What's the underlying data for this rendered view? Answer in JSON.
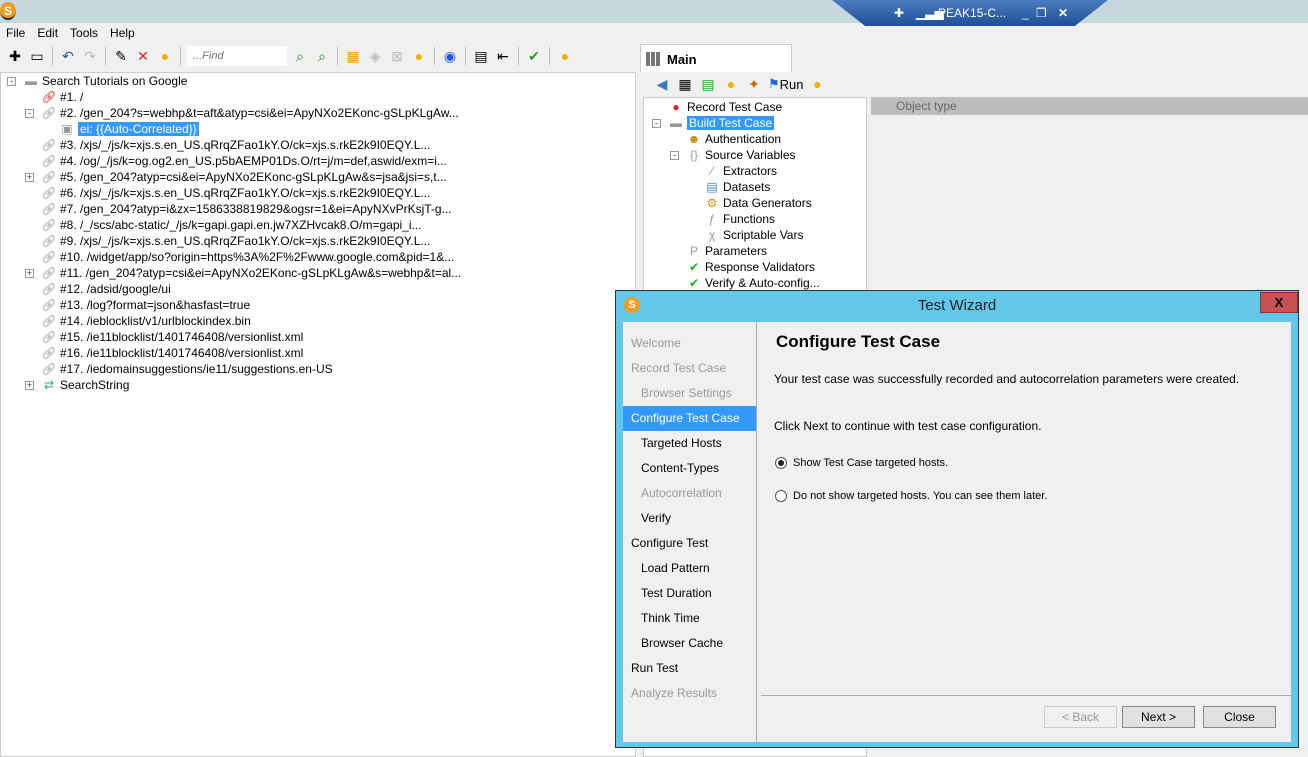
{
  "titlebar": {
    "remote_session": "PEAK15-C..."
  },
  "menu": [
    "File",
    "Edit",
    "Tools",
    "Help"
  ],
  "toolbar": {
    "find_placeholder": "...Find",
    "icons": [
      "add-icon",
      "remove-icon",
      "undo-icon",
      "redo-icon",
      "edit-icon",
      "delete-icon",
      "hint-icon",
      "find-prev-icon",
      "find-next-icon",
      "hosts-icon",
      "correlate-icon",
      "disabled-icon",
      "hint-icon",
      "view-icon",
      "details-icon",
      "collapse-icon",
      "verify-icon",
      "hint-icon"
    ]
  },
  "left_tree": {
    "root": "Search Tutorials on Google",
    "items": [
      {
        "label": "#1. /",
        "level": 1,
        "icon": "link-red-icon"
      },
      {
        "label": "#2. /gen_204?s=webhp&t=aft&atyp=csi&ei=ApyNXo2EKonc-gSLpKLgAw...",
        "level": 1,
        "icon": "link-icon",
        "expander": "-"
      },
      {
        "label": "ei: {{Auto-Correlated}}",
        "level": 2,
        "icon": "parameter-icon",
        "selected": true
      },
      {
        "label": "#3. /xjs/_/js/k=xjs.s.en_US.qRrqZFao1kY.O/ck=xjs.s.rkE2k9I0EQY.L...",
        "level": 1,
        "icon": "link-icon"
      },
      {
        "label": "#4. /og/_/js/k=og.og2.en_US.p5bAEMP01Ds.O/rt=j/m=def,aswid/exm=i...",
        "level": 1,
        "icon": "link-icon"
      },
      {
        "label": "#5. /gen_204?atyp=csi&ei=ApyNXo2EKonc-gSLpKLgAw&s=jsa&jsi=s,t...",
        "level": 1,
        "icon": "link-icon",
        "expander": "+"
      },
      {
        "label": "#6. /xjs/_/js/k=xjs.s.en_US.qRrqZFao1kY.O/ck=xjs.s.rkE2k9I0EQY.L...",
        "level": 1,
        "icon": "link-icon"
      },
      {
        "label": "#7. /gen_204?atyp=i&zx=1586338819829&ogsr=1&ei=ApyNXvPrKsjT-g...",
        "level": 1,
        "icon": "link-icon"
      },
      {
        "label": "#8. /_/scs/abc-static/_/js/k=gapi.gapi.en.jw7XZHvcak8.O/m=gapi_i...",
        "level": 1,
        "icon": "link-icon"
      },
      {
        "label": "#9. /xjs/_/js/k=xjs.s.en_US.qRrqZFao1kY.O/ck=xjs.s.rkE2k9I0EQY.L...",
        "level": 1,
        "icon": "link-icon"
      },
      {
        "label": "#10. /widget/app/so?origin=https%3A%2F%2Fwww.google.com&pid=1&...",
        "level": 1,
        "icon": "link-icon"
      },
      {
        "label": "#11. /gen_204?atyp=csi&ei=ApyNXo2EKonc-gSLpKLgAw&s=webhp&t=al...",
        "level": 1,
        "icon": "link-icon",
        "expander": "+"
      },
      {
        "label": "#12. /adsid/google/ui",
        "level": 1,
        "icon": "link-icon"
      },
      {
        "label": "#13. /log?format=json&hasfast=true",
        "level": 1,
        "icon": "link-icon"
      },
      {
        "label": "#14. /ieblocklist/v1/urlblockindex.bin",
        "level": 1,
        "icon": "link-icon"
      },
      {
        "label": "#15. /ie11blocklist/1401746408/versionlist.xml",
        "level": 1,
        "icon": "link-icon"
      },
      {
        "label": "#16. /ie11blocklist/1401746408/versionlist.xml",
        "level": 1,
        "icon": "link-icon"
      },
      {
        "label": "#17. /iedomainsuggestions/ie11/suggestions.en-US",
        "level": 1,
        "icon": "link-icon"
      },
      {
        "label": "SearchString",
        "level": 1,
        "icon": "loop-icon",
        "expander": "+"
      }
    ]
  },
  "main_tab": {
    "label": "Main",
    "run_label": "Run"
  },
  "right_tree": [
    {
      "label": "Record Test Case",
      "level": 0,
      "icon": "record-icon"
    },
    {
      "label": "Build Test Case",
      "level": 0,
      "icon": "briefcase-icon",
      "selected": true,
      "expander": "-"
    },
    {
      "label": "Authentication",
      "level": 1,
      "icon": "user-lock-icon"
    },
    {
      "label": "Source Variables",
      "level": 1,
      "icon": "braces-icon",
      "expander": "-"
    },
    {
      "label": "Extractors",
      "level": 2,
      "icon": "extractor-icon"
    },
    {
      "label": "Datasets",
      "level": 2,
      "icon": "dataset-icon"
    },
    {
      "label": "Data Generators",
      "level": 2,
      "icon": "generator-icon"
    },
    {
      "label": "Functions",
      "level": 2,
      "icon": "function-icon"
    },
    {
      "label": "Scriptable Vars",
      "level": 2,
      "icon": "script-var-icon"
    },
    {
      "label": "Parameters",
      "level": 1,
      "icon": "parameters-icon"
    },
    {
      "label": "Response Validators",
      "level": 1,
      "icon": "validator-icon"
    },
    {
      "label": "Verify & Auto-config...",
      "level": 1,
      "icon": "check-icon"
    }
  ],
  "object_panel": {
    "header": "Object type"
  },
  "wizard": {
    "title": "Test Wizard",
    "close": "X",
    "nav": [
      {
        "label": "Welcome",
        "sub": false,
        "state": "disabled"
      },
      {
        "label": "Record Test Case",
        "sub": false,
        "state": "disabled"
      },
      {
        "label": "Browser Settings",
        "sub": true,
        "state": "disabled"
      },
      {
        "label": "Configure Test Case",
        "sub": false,
        "state": "active"
      },
      {
        "label": "Targeted Hosts",
        "sub": true,
        "state": "normal"
      },
      {
        "label": "Content-Types",
        "sub": true,
        "state": "normal"
      },
      {
        "label": "Autocorrelation",
        "sub": true,
        "state": "disabled"
      },
      {
        "label": "Verify",
        "sub": true,
        "state": "normal"
      },
      {
        "label": "Configure Test",
        "sub": false,
        "state": "normal"
      },
      {
        "label": "Load Pattern",
        "sub": true,
        "state": "normal"
      },
      {
        "label": "Test Duration",
        "sub": true,
        "state": "normal"
      },
      {
        "label": "Think Time",
        "sub": true,
        "state": "normal"
      },
      {
        "label": "Browser Cache",
        "sub": true,
        "state": "normal"
      },
      {
        "label": "Run Test",
        "sub": false,
        "state": "normal"
      },
      {
        "label": "Analyze Results",
        "sub": false,
        "state": "disabled"
      }
    ],
    "heading": "Configure Test Case",
    "paragraph1": "Your test case was successfully recorded and autocorrelation parameters were created.",
    "paragraph2": "Click Next to continue with test case configuration.",
    "options": [
      {
        "label": "Show Test Case targeted hosts.",
        "checked": true
      },
      {
        "label": "Do not show targeted hosts. You can see them later.",
        "checked": false
      }
    ],
    "buttons": {
      "back": "< Back",
      "next": "Next >",
      "close": "Close"
    }
  }
}
